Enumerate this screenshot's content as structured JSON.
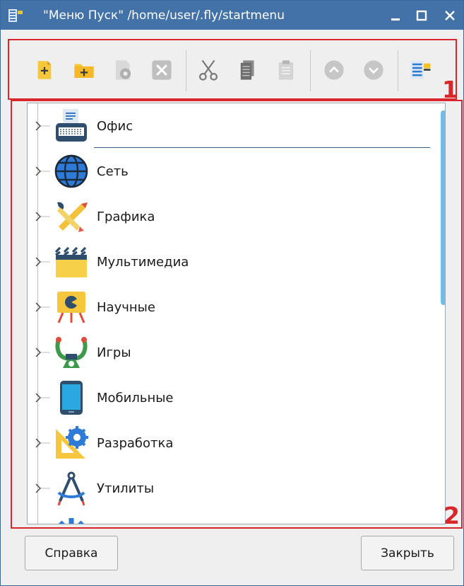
{
  "window": {
    "title": "\"Меню Пуск\" /home/user/.fly/startmenu",
    "title_color": "#4272a8"
  },
  "toolbar": {
    "buttons": [
      {
        "name": "new-item-icon",
        "enabled": true
      },
      {
        "name": "new-folder-icon",
        "enabled": true
      },
      {
        "name": "properties-icon",
        "enabled": false
      },
      {
        "name": "delete-icon",
        "enabled": false
      },
      {
        "name": "cut-icon",
        "enabled": false
      },
      {
        "name": "copy-icon",
        "enabled": false
      },
      {
        "name": "paste-icon",
        "enabled": false
      },
      {
        "name": "move-up-icon",
        "enabled": false
      },
      {
        "name": "move-down-icon",
        "enabled": false
      },
      {
        "name": "settings-list-icon",
        "enabled": true
      }
    ]
  },
  "markers": {
    "one": "1",
    "two": "2"
  },
  "tree": {
    "items": [
      {
        "label": "Офис",
        "icon": "office-icon"
      },
      {
        "label": "Сеть",
        "icon": "network-icon"
      },
      {
        "label": "Графика",
        "icon": "graphics-icon"
      },
      {
        "label": "Мультимедиа",
        "icon": "multimedia-icon"
      },
      {
        "label": "Научные",
        "icon": "science-icon"
      },
      {
        "label": "Игры",
        "icon": "games-icon"
      },
      {
        "label": "Мобильные",
        "icon": "mobile-icon"
      },
      {
        "label": "Разработка",
        "icon": "development-icon"
      },
      {
        "label": "Утилиты",
        "icon": "utilities-icon"
      }
    ]
  },
  "footer": {
    "help_label": "Справка",
    "close_label": "Закрыть"
  },
  "colors": {
    "accent": "#d8262b",
    "scrollbar": "#6fbee9"
  }
}
